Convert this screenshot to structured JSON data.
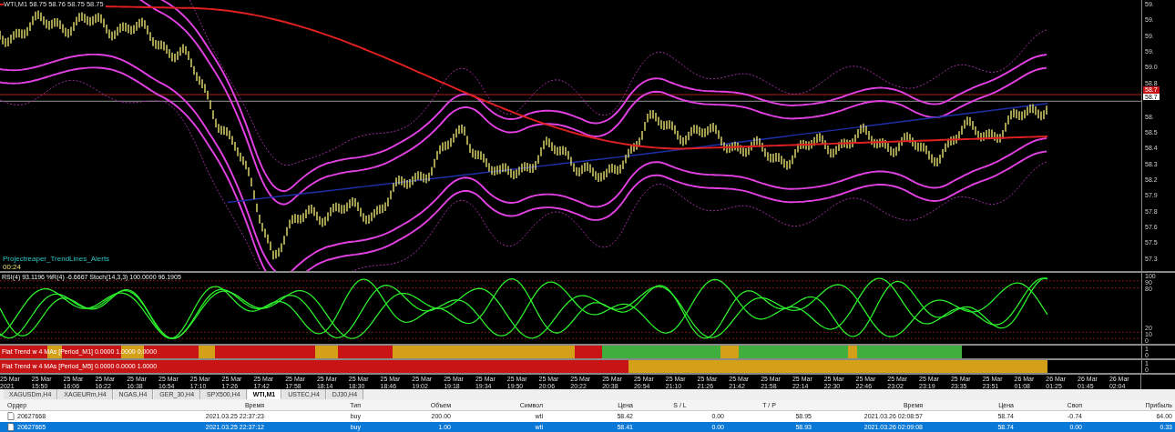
{
  "chart": {
    "title": "WTI,M1  58.75 58.76 58.75 58.75",
    "indicator_name": "Projectreaper_TrendLines_Alerts",
    "timer": "00:24",
    "price_labels": [
      {
        "text": "59.",
        "kind": "tick"
      },
      {
        "text": "59.",
        "kind": "tick"
      },
      {
        "text": "59.",
        "kind": "tick"
      },
      {
        "text": "59.",
        "kind": "tick"
      },
      {
        "text": "59.0",
        "kind": "tick"
      },
      {
        "text": "58.8",
        "kind": "tick"
      },
      {
        "text": "58.7",
        "kind": "bid"
      },
      {
        "text": "58.7",
        "kind": "ask"
      },
      {
        "text": "58.",
        "kind": "tick"
      },
      {
        "text": "58.5",
        "kind": "tick"
      },
      {
        "text": "58.4",
        "kind": "tick"
      },
      {
        "text": "58.3",
        "kind": "tick"
      },
      {
        "text": "58.2",
        "kind": "tick"
      },
      {
        "text": "57.9",
        "kind": "tick"
      },
      {
        "text": "57.8",
        "kind": "tick"
      },
      {
        "text": "57.6",
        "kind": "tick"
      },
      {
        "text": "57.5",
        "kind": "tick"
      },
      {
        "text": "57.3",
        "kind": "tick"
      }
    ]
  },
  "oscillator": {
    "legend": "RSI(4) 93.1196  %R(4) -6.6667  Stoch(14,3,3) 100.0000 96.1905",
    "levels": [
      "100",
      "90",
      "80",
      "20",
      "10",
      "0"
    ]
  },
  "trend_bars": [
    {
      "legend": "Flat Trend w 4 MAs [Period_M1] 0.0000 1.0000 0.0000",
      "axis": [
        "1",
        "0"
      ]
    },
    {
      "legend": "Flat Trend w 4 MAs [Period_M5] 0.0000 0.0000 1.0000",
      "axis": [
        "1",
        "0"
      ]
    }
  ],
  "time_axis": [
    "25 Mar 2021",
    "25 Mar 15:50",
    "25 Mar 16:06",
    "25 Mar 16:22",
    "25 Mar 16:38",
    "25 Mar 16:54",
    "25 Mar 17:10",
    "25 Mar 17:26",
    "25 Mar 17:42",
    "25 Mar 17:58",
    "25 Mar 18:14",
    "25 Mar 18:30",
    "25 Mar 18:46",
    "25 Mar 19:02",
    "25 Mar 19:18",
    "25 Mar 19:34",
    "25 Mar 19:50",
    "25 Mar 20:06",
    "25 Mar 20:22",
    "25 Mar 20:38",
    "25 Mar 20:54",
    "25 Mar 21:10",
    "25 Mar 21:26",
    "25 Mar 21:42",
    "25 Mar 21:58",
    "25 Mar 22:14",
    "25 Mar 22:30",
    "25 Mar 22:46",
    "25 Mar 23:02",
    "25 Mar 23:19",
    "25 Mar 23:35",
    "25 Mar 23:51",
    "26 Mar 01:08",
    "26 Mar 01:25",
    "26 Mar 01:45",
    "26 Mar 02:04"
  ],
  "symbol_tabs": [
    {
      "label": "XAGUSDm,H4",
      "selected": false
    },
    {
      "label": "XAGEURm,H4",
      "selected": false
    },
    {
      "label": "NGAS,H4",
      "selected": false
    },
    {
      "label": "GER_30,H4",
      "selected": false
    },
    {
      "label": "SPX500,H4",
      "selected": false
    },
    {
      "label": "WTI,M1",
      "selected": true
    },
    {
      "label": "USTEC,H4",
      "selected": false
    },
    {
      "label": "DJ30,H4",
      "selected": false
    }
  ],
  "trades": {
    "columns": [
      "Ордер",
      "Время",
      "Тип",
      "Объем",
      "Символ",
      "Цена",
      "S / L",
      "T / P",
      "Время",
      "Цена",
      "Своп",
      "Прибыль"
    ],
    "rows": [
      {
        "selected": false,
        "cells": [
          "20627668",
          "2021.03.25 22:37:23",
          "buy",
          "200.00",
          "wti",
          "58.42",
          "0.00",
          "58.95",
          "2021.03.26 02:08:57",
          "58.74",
          "-0.74",
          "64.00"
        ]
      },
      {
        "selected": true,
        "cells": [
          "20627665",
          "2021.03.25 22:37:12",
          "buy",
          "1.00",
          "wti",
          "58.41",
          "0.00",
          "58.93",
          "2021.03.26 02:09:08",
          "58.74",
          "0.00",
          "0.33"
        ]
      }
    ]
  }
}
